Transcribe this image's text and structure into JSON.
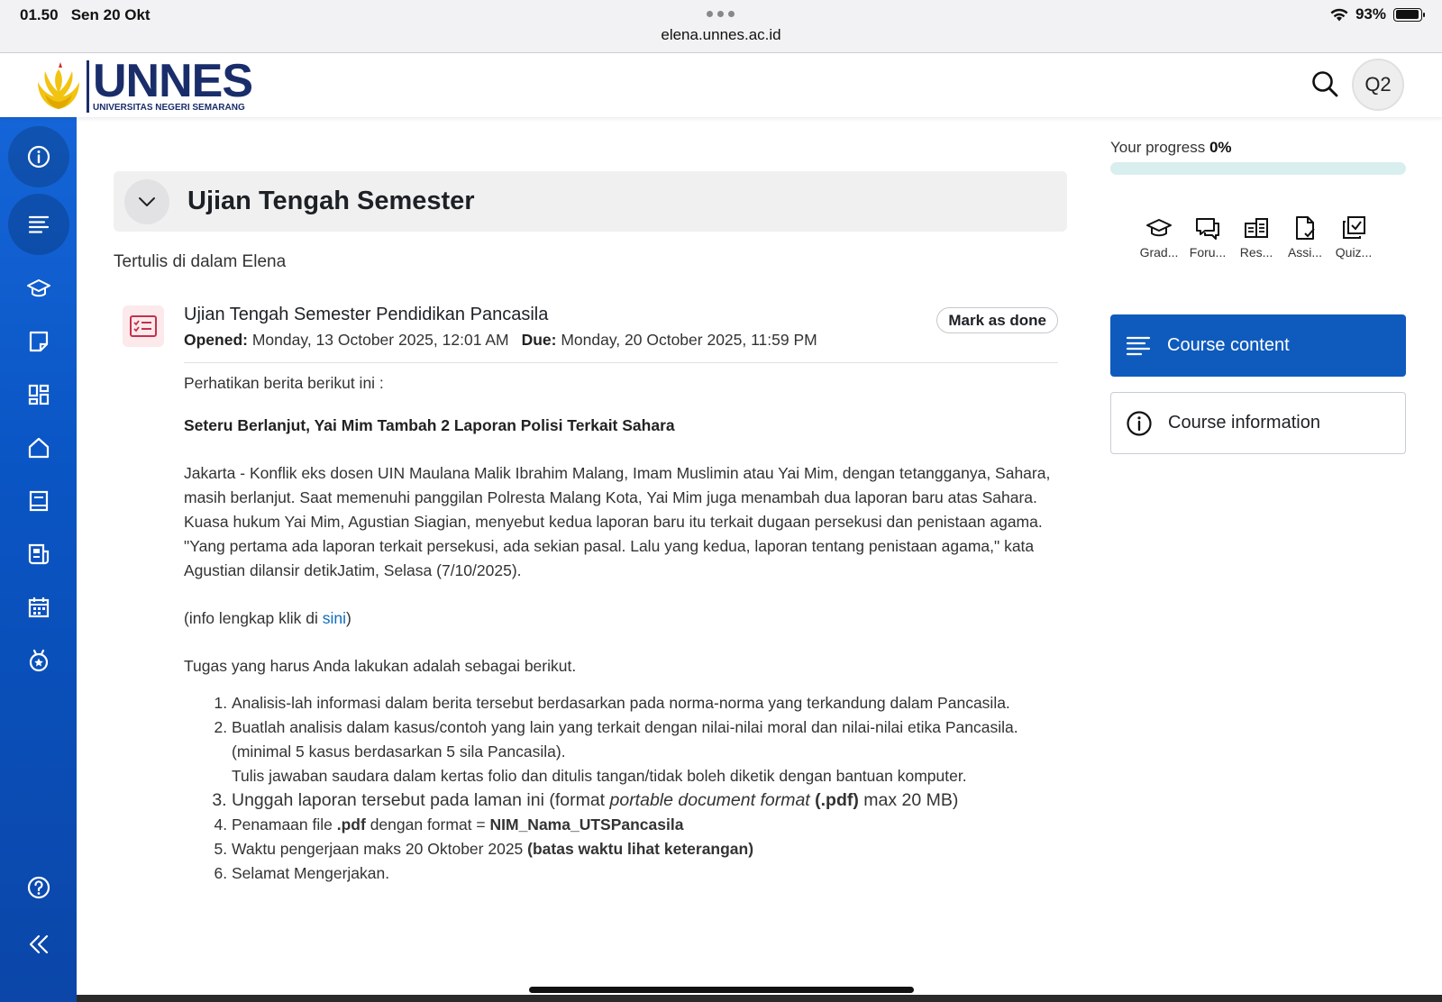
{
  "status_bar": {
    "time": "01.50",
    "date": "Sen 20 Okt",
    "url": "elena.unnes.ac.id",
    "battery": "93%"
  },
  "header": {
    "logo_main": "UNNES",
    "logo_sub": "UNIVERSITAS NEGERI SEMARANG",
    "avatar_initials": "Q2"
  },
  "rail": {
    "icons": [
      "info-icon",
      "course-index-icon",
      "grades-icon",
      "notes-icon",
      "dashboard-icon",
      "home-icon",
      "book-icon",
      "news-icon",
      "calendar-icon",
      "badges-icon",
      "help-icon",
      "collapse-icon"
    ]
  },
  "section": {
    "title": "Ujian Tengah Semester",
    "summary": "Tertulis di dalam Elena"
  },
  "activity": {
    "name": "Ujian Tengah Semester Pendidikan Pancasila",
    "mark_done": "Mark as done",
    "opened_label": "Opened:",
    "opened_value": "Monday, 13 October 2025, 12:01 AM",
    "due_label": "Due:",
    "due_value": "Monday, 20 October 2025, 11:59 PM"
  },
  "description": {
    "intro": "Perhatikan berita berikut ini :",
    "headline": "Seteru Berlanjut, Yai Mim Tambah 2 Laporan Polisi Terkait Sahara",
    "body": "Jakarta - Konflik eks dosen UIN Maulana Malik Ibrahim Malang, Imam Muslimin atau Yai Mim, dengan tetangganya, Sahara, masih berlanjut. Saat memenuhi panggilan Polresta Malang Kota, Yai Mim juga menambah dua laporan baru atas Sahara. Kuasa hukum Yai Mim, Agustian Siagian, menyebut kedua laporan baru itu terkait dugaan persekusi dan penistaan agama. \"Yang pertama ada laporan terkait persekusi, ada sekian pasal. Lalu yang kedua, laporan tentang penistaan agama,\" kata Agustian dilansir detikJatim, Selasa (7/10/2025).",
    "info_prefix": "(info lengkap klik di ",
    "info_link": "sini",
    "info_suffix": ")",
    "task_intro": "Tugas yang harus Anda lakukan adalah sebagai berikut.",
    "item1": "Analisis-lah informasi dalam berita tersebut berdasarkan pada norma-norma yang terkandung dalam Pancasila.",
    "item2_line1": "Buatlah analisis dalam kasus/contoh yang lain yang terkait dengan nilai-nilai moral dan nilai-nilai etika Pancasila. (minimal 5 kasus berdasarkan 5 sila Pancasila).",
    "item2_line2": "Tulis jawaban saudara dalam kertas folio dan ditulis tangan/tidak boleh diketik dengan bantuan komputer.",
    "item3_a": "Unggah laporan tersebut pada laman ini (format ",
    "item3_italic": "portable document format",
    "item3_bold": " (.pdf)",
    "item3_b": " max 20 MB)",
    "item4_a": "Penamaan file ",
    "item4_bold1": ".pdf",
    "item4_b": " dengan format = ",
    "item4_bold2": "NIM_Nama_UTSPancasila",
    "item5_a": "Waktu pengerjaan maks 20 Oktober 2025 ",
    "item5_bold": "(batas waktu lihat keterangan)",
    "item6": "Selamat Mengerjakan."
  },
  "drawer": {
    "progress_label": "Your progress",
    "progress_value": "0%",
    "progress_fraction": 0,
    "quick_links": [
      {
        "label": "Grad...",
        "icon": "grades-icon"
      },
      {
        "label": "Foru...",
        "icon": "forum-icon"
      },
      {
        "label": "Res...",
        "icon": "resources-icon"
      },
      {
        "label": "Assi...",
        "icon": "assignment-icon"
      },
      {
        "label": "Quiz...",
        "icon": "quiz-icon"
      }
    ],
    "course_content": "Course content",
    "course_information": "Course information"
  }
}
